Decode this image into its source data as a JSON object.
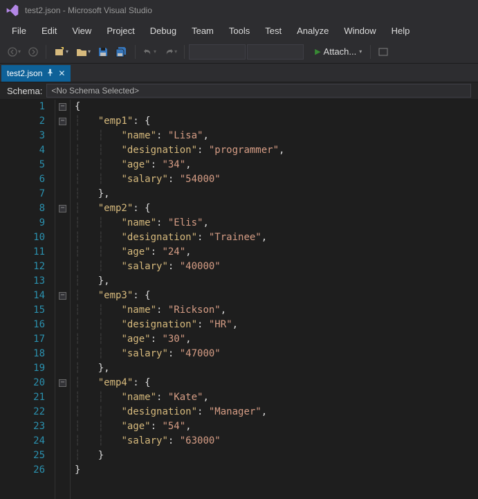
{
  "titlebar": {
    "title": "test2.json - Microsoft Visual Studio"
  },
  "menubar": {
    "items": {
      "file": "File",
      "edit": "Edit",
      "view": "View",
      "project": "Project",
      "debug": "Debug",
      "team": "Team",
      "tools": "Tools",
      "test": "Test",
      "analyze": "Analyze",
      "window": "Window",
      "help": "Help"
    }
  },
  "toolbar": {
    "attach": "Attach...",
    "combo1": "",
    "combo2": ""
  },
  "tab": {
    "name": "test2.json"
  },
  "schema": {
    "label": "Schema:",
    "value": "<No Schema Selected>"
  },
  "code": {
    "lines": [
      {
        "n": "1",
        "pre": "",
        "t": "{"
      },
      {
        "n": "2",
        "pre": "    ",
        "k": "\"emp1\"",
        "t": ": {"
      },
      {
        "n": "3",
        "pre": "        ",
        "k": "\"name\"",
        "t": ": ",
        "s": "\"Lisa\"",
        "tail": ","
      },
      {
        "n": "4",
        "pre": "        ",
        "k": "\"designation\"",
        "t": ": ",
        "s": "\"programmer\"",
        "tail": ","
      },
      {
        "n": "5",
        "pre": "        ",
        "k": "\"age\"",
        "t": ": ",
        "s": "\"34\"",
        "tail": ","
      },
      {
        "n": "6",
        "pre": "        ",
        "k": "\"salary\"",
        "t": ": ",
        "s": "\"54000\"",
        "tail": ""
      },
      {
        "n": "7",
        "pre": "    ",
        "t": "},"
      },
      {
        "n": "8",
        "pre": "    ",
        "k": "\"emp2\"",
        "t": ": {"
      },
      {
        "n": "9",
        "pre": "        ",
        "k": "\"name\"",
        "t": ": ",
        "s": "\"Elis\"",
        "tail": ","
      },
      {
        "n": "10",
        "pre": "        ",
        "k": "\"designation\"",
        "t": ": ",
        "s": "\"Trainee\"",
        "tail": ","
      },
      {
        "n": "11",
        "pre": "        ",
        "k": "\"age\"",
        "t": ": ",
        "s": "\"24\"",
        "tail": ","
      },
      {
        "n": "12",
        "pre": "        ",
        "k": "\"salary\"",
        "t": ": ",
        "s": "\"40000\"",
        "tail": ""
      },
      {
        "n": "13",
        "pre": "    ",
        "t": "},"
      },
      {
        "n": "14",
        "pre": "    ",
        "k": "\"emp3\"",
        "t": ": {"
      },
      {
        "n": "15",
        "pre": "        ",
        "k": "\"name\"",
        "t": ": ",
        "s": "\"Rickson\"",
        "tail": ","
      },
      {
        "n": "16",
        "pre": "        ",
        "k": "\"designation\"",
        "t": ": ",
        "s": "\"HR\"",
        "tail": ","
      },
      {
        "n": "17",
        "pre": "        ",
        "k": "\"age\"",
        "t": ": ",
        "s": "\"30\"",
        "tail": ","
      },
      {
        "n": "18",
        "pre": "        ",
        "k": "\"salary\"",
        "t": ": ",
        "s": "\"47000\"",
        "tail": ""
      },
      {
        "n": "19",
        "pre": "    ",
        "t": "},"
      },
      {
        "n": "20",
        "pre": "    ",
        "k": "\"emp4\"",
        "t": ": {"
      },
      {
        "n": "21",
        "pre": "        ",
        "k": "\"name\"",
        "t": ": ",
        "s": "\"Kate\"",
        "tail": ","
      },
      {
        "n": "22",
        "pre": "        ",
        "k": "\"designation\"",
        "t": ": ",
        "s": "\"Manager\"",
        "tail": ","
      },
      {
        "n": "23",
        "pre": "        ",
        "k": "\"age\"",
        "t": ": ",
        "s": "\"54\"",
        "tail": ","
      },
      {
        "n": "24",
        "pre": "        ",
        "k": "\"salary\"",
        "t": ": ",
        "s": "\"63000\"",
        "tail": ""
      },
      {
        "n": "25",
        "pre": "    ",
        "t": "}"
      },
      {
        "n": "26",
        "pre": "",
        "t": "}"
      }
    ],
    "foldLines": [
      1,
      2,
      8,
      14,
      20
    ]
  }
}
